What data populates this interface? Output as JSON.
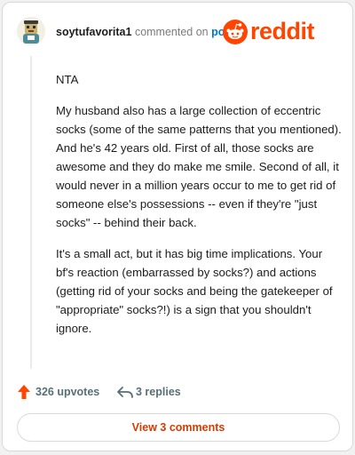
{
  "comment": {
    "username": "soytufavorita1",
    "action_text": "commented on",
    "post_link": "post",
    "paragraphs": [
      "NTA",
      "My husband also has a large collection of eccentric socks (some of the same patterns that you mentioned). And he's 42 years old. First of all, those socks are awesome and they do make me smile. Second of all, it would never in a million years occur to me to get rid of someone else's possessions -- even if they're \"just socks\" -- behind their back.",
      "It's a small act, but it has big time implications. Your bf's reaction (embarrassed by socks?) and actions (getting rid of your socks and being the gatekeeper of \"appropriate\" socks?!) is a sign that you shouldn't ignore."
    ],
    "upvotes": "326 upvotes",
    "replies": "3 replies"
  },
  "brand": {
    "wordmark": "reddit",
    "color": "#ff4500"
  },
  "footer": {
    "view_button": "View 3 comments"
  },
  "icons": [
    "avatar",
    "reddit-logo-icon",
    "upvote-arrow-icon",
    "reply-arrow-icon"
  ]
}
